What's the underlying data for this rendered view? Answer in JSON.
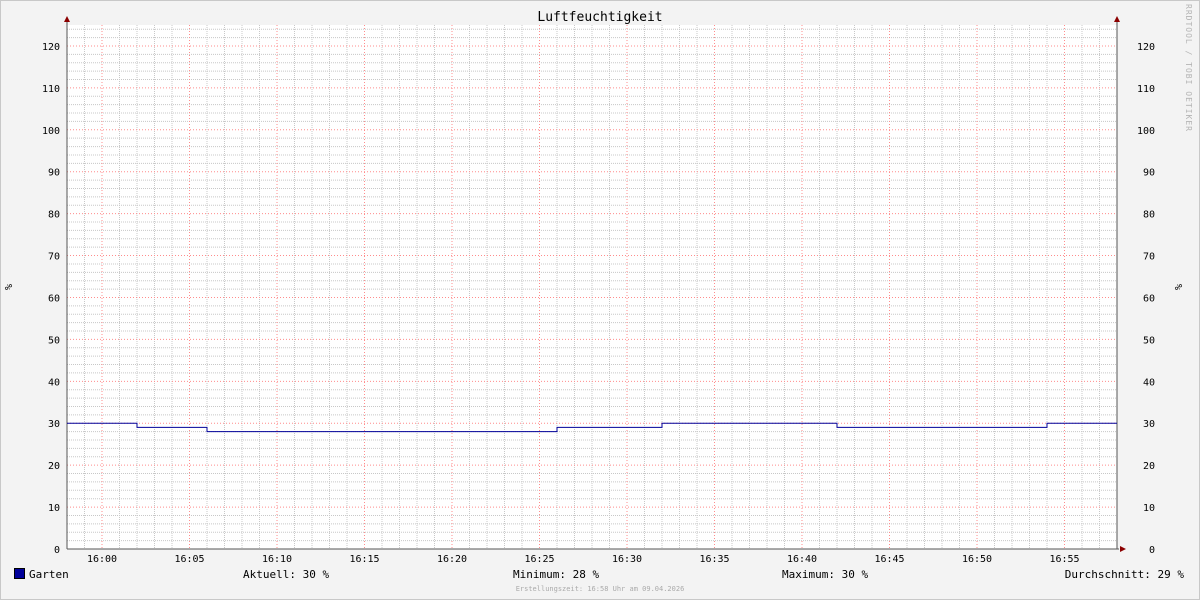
{
  "chart_data": {
    "type": "line",
    "title": "Luftfeuchtigkeit",
    "ylabel": "%",
    "ylim": [
      0,
      125
    ],
    "yticks": [
      0,
      10,
      20,
      30,
      40,
      50,
      60,
      70,
      80,
      90,
      100,
      110,
      120
    ],
    "xlabels": [
      "16:00",
      "16:05",
      "16:10",
      "16:15",
      "16:20",
      "16:25",
      "16:30",
      "16:35",
      "16:40",
      "16:45",
      "16:50",
      "16:55"
    ],
    "x_unit": "minutes after 16:00",
    "xlim": [
      -2,
      58
    ],
    "grid": true,
    "legend": "bottom",
    "series": [
      {
        "name": "Garten",
        "color": "#000099",
        "x": [
          -2,
          2,
          2,
          6,
          6,
          26,
          26,
          32,
          32,
          42,
          42,
          54,
          54,
          58
        ],
        "values": [
          30,
          30,
          29,
          29,
          28,
          28,
          29,
          29,
          30,
          30,
          29,
          29,
          30,
          30
        ]
      }
    ]
  },
  "legend": {
    "series_name": "Garten",
    "current": "Aktuell:  30 %",
    "minimum": "Minimum:  28 %",
    "maximum": "Maximum:  30 %",
    "average": "Durchschnitt:  29 %"
  },
  "watermark": "RRDTOOL / TOBI OETIKER",
  "footer": "Erstellungszeit: 16:58 Uhr am 09.04.2026",
  "colors": {
    "line": "#000099",
    "major_grid": "#ff8c8c",
    "minor_grid": "#c8c8c8",
    "plot_background": "#ffffff",
    "axis_arrow": "#8b0000"
  }
}
